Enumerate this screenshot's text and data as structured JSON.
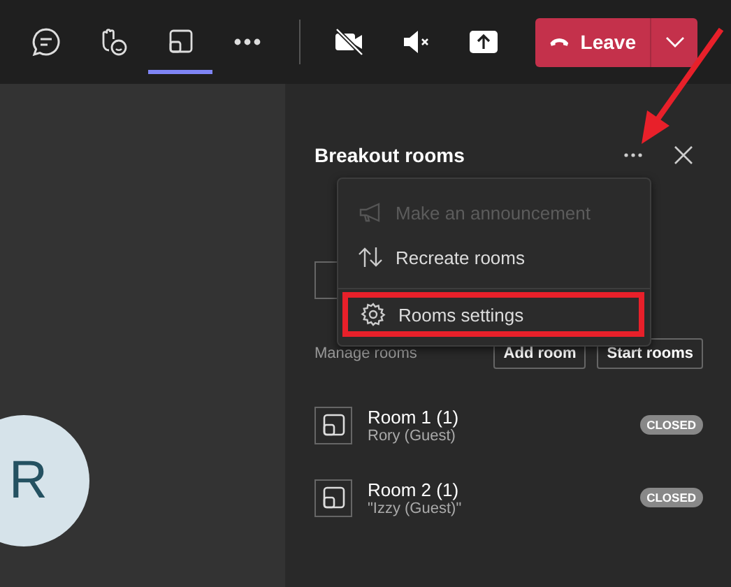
{
  "toolbar": {
    "buttons": [
      {
        "kind": "chat",
        "selected": false
      },
      {
        "kind": "react",
        "selected": false
      },
      {
        "kind": "rooms",
        "selected": true
      },
      {
        "kind": "more",
        "selected": false
      },
      {
        "kind": "camera_off",
        "selected": false
      },
      {
        "kind": "mic_muted",
        "selected": false
      },
      {
        "kind": "share",
        "selected": false
      }
    ],
    "leave": {
      "label": "Leave"
    }
  },
  "stage": {
    "avatar_initial": "R"
  },
  "panel": {
    "title": "Breakout rooms",
    "menu": [
      {
        "kind": "announce",
        "label": "Make an announcement",
        "disabled": true,
        "highlighted": false
      },
      {
        "kind": "recreate",
        "label": "Recreate rooms",
        "disabled": false,
        "highlighted": false
      },
      {
        "kind": "settings",
        "label": "Rooms settings",
        "disabled": false,
        "highlighted": true
      }
    ],
    "manage_label": "Manage rooms",
    "buttons": [
      "Add room",
      "Start rooms"
    ],
    "rooms": [
      {
        "name": "Room 1 (1)",
        "participant": "Rory (Guest)",
        "status": "CLOSED"
      },
      {
        "name": "Room 2 (1)",
        "participant": "\"Izzy (Guest)\"",
        "status": "CLOSED"
      }
    ]
  }
}
